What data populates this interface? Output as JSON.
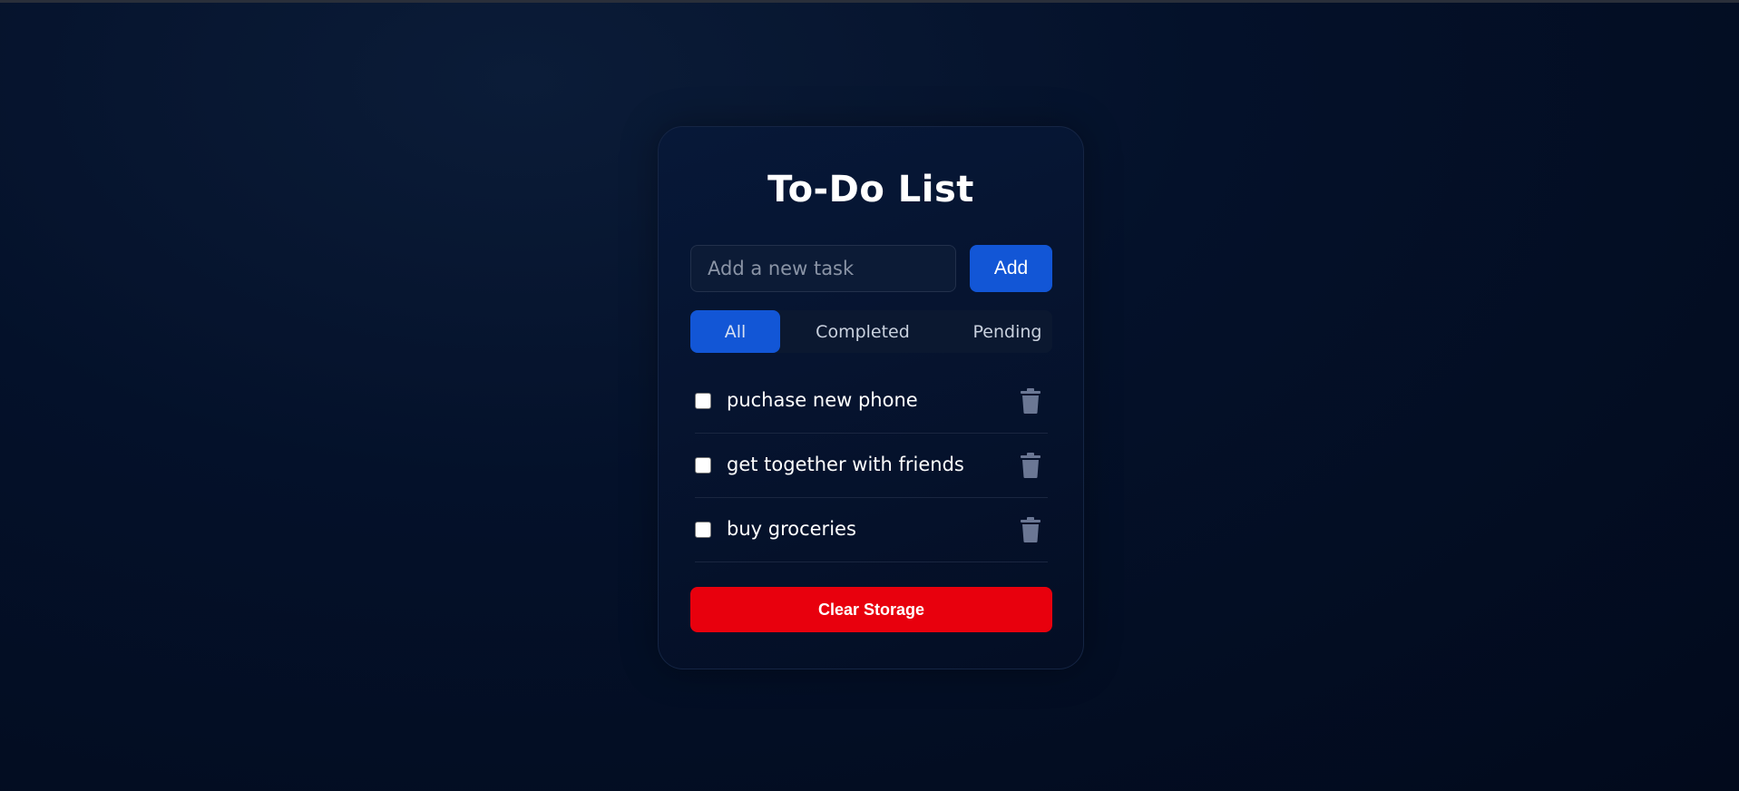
{
  "app": {
    "title": "To-Do List"
  },
  "new_task": {
    "placeholder": "Add a new task",
    "value": "",
    "add_label": "Add"
  },
  "filters": [
    {
      "label": "All",
      "active": true
    },
    {
      "label": "Completed",
      "active": false
    },
    {
      "label": "Pending",
      "active": false
    }
  ],
  "tasks": [
    {
      "text": "puchase new phone",
      "done": false,
      "delete_icon": "trash-icon"
    },
    {
      "text": "get together with friends",
      "done": false,
      "delete_icon": "trash-icon"
    },
    {
      "text": "buy groceries",
      "done": false,
      "delete_icon": "trash-icon"
    }
  ],
  "clear_label": "Clear Storage",
  "colors": {
    "accent": "#1256d6",
    "danger": "#e8000d",
    "icon": "#6b7794"
  }
}
